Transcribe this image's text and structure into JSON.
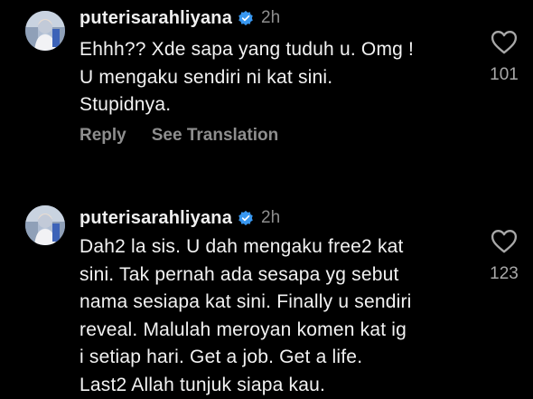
{
  "comments": [
    {
      "username": "puterisarahliyana",
      "time": "2h",
      "lines": [
        "Ehhh?? Xde sapa yang tuduh u. Omg !",
        "U mengaku sendiri ni kat sini.",
        "Stupidnya."
      ],
      "reply_label": "Reply",
      "translate_label": "See Translation",
      "likes": "101"
    },
    {
      "username": "puterisarahliyana",
      "time": "2h",
      "lines": [
        "Dah2 la sis. U dah mengaku free2 kat",
        "sini. Tak pernah ada sesapa yg sebut",
        "nama sesiapa kat sini. Finally u sendiri",
        "reveal. Malulah meroyan komen kat ig",
        "i setiap hari. Get a job. Get a life.",
        "Last2 Allah tunjuk siapa kau."
      ],
      "likes": "123"
    }
  ],
  "colors": {
    "background": "#000000",
    "text": "#f2f2f2",
    "muted": "#8e8e8e",
    "verified": "#3897f0"
  },
  "icons": [
    "avatar",
    "verified-badge-icon",
    "heart-icon"
  ]
}
